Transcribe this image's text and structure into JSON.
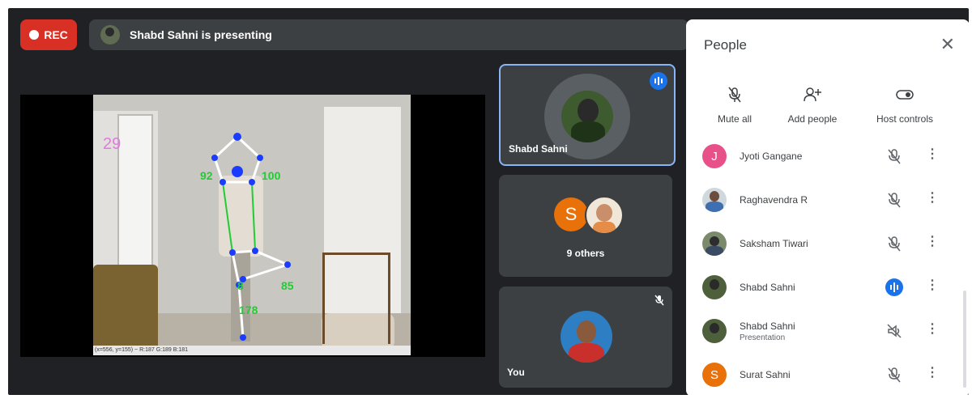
{
  "recording": {
    "label": "REC"
  },
  "presenting": {
    "text": "Shabd Sahni is presenting"
  },
  "presentation": {
    "frame_number": "29",
    "angles": [
      "92",
      "100",
      "85",
      "8",
      "178"
    ],
    "coords": "(x=556, y=155) ~ R:187 G:189 B:181"
  },
  "tiles": [
    {
      "name": "Shabd Sahni"
    },
    {
      "others_label": "9 others",
      "letter": "S"
    },
    {
      "name": "You"
    }
  ],
  "people": {
    "title": "People",
    "actions": [
      {
        "label": "Mute all",
        "icon": "mic-off-icon"
      },
      {
        "label": "Add people",
        "icon": "add-person-icon"
      },
      {
        "label": "Host controls",
        "icon": "toggle-icon"
      }
    ],
    "list": [
      {
        "name": "Jyoti Gangane",
        "sub": "",
        "letter": "J",
        "status": "muted"
      },
      {
        "name": "Raghavendra R",
        "sub": "",
        "letter": "",
        "status": "muted"
      },
      {
        "name": "Saksham Tiwari",
        "sub": "",
        "letter": "",
        "status": "muted"
      },
      {
        "name": "Shabd Sahni",
        "sub": "",
        "letter": "",
        "status": "speaking"
      },
      {
        "name": "Shabd Sahni",
        "sub": "Presentation",
        "letter": "",
        "status": "presentation-muted"
      },
      {
        "name": "Surat Sahni",
        "sub": "",
        "letter": "S",
        "status": "muted"
      }
    ]
  },
  "colors": {
    "rec_red": "#d93025",
    "accent_blue": "#1a73e8",
    "pink_avatar": "#e8508a",
    "orange_avatar": "#e8710a"
  }
}
